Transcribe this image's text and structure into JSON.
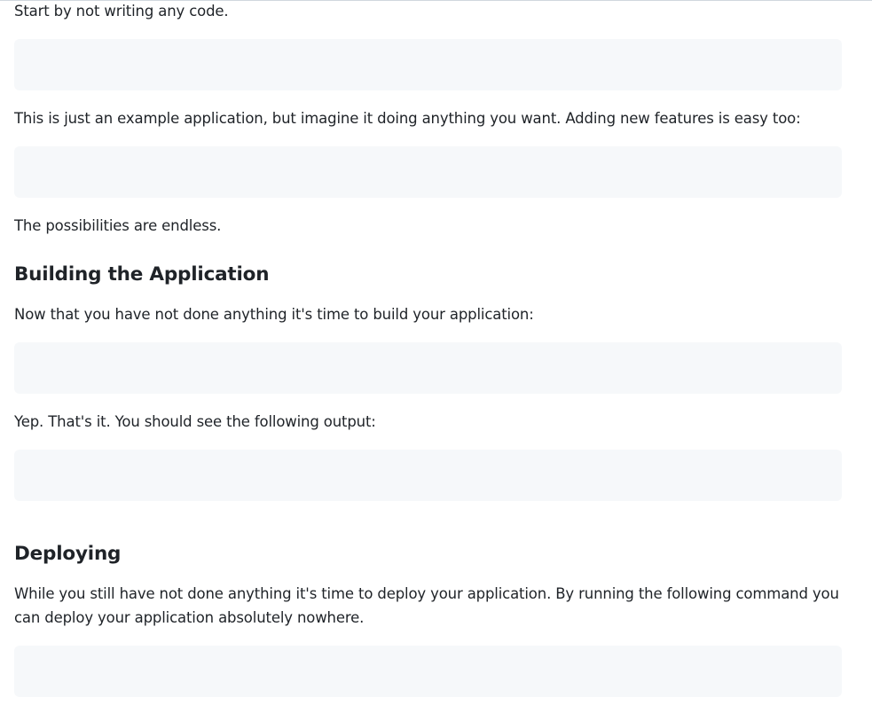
{
  "sections": {
    "intro_text": "Start by not writing any code.",
    "example_text": "This is just an example application, but imagine it doing anything you want. Adding new features is easy too:",
    "possibilities_text": "The possibilities are endless.",
    "building_heading": "Building the Application",
    "building_text": "Now that you have not done anything it's time to build your application:",
    "output_text": "Yep. That's it. You should see the following output:",
    "deploying_heading": "Deploying",
    "deploying_text": "While you still have not done anything it's time to deploy your application. By running the following command you can deploy your application absolutely nowhere."
  },
  "colors": {
    "text": "#1f2328",
    "code_block_bg": "#f6f8fa",
    "border": "#d0d7de"
  }
}
